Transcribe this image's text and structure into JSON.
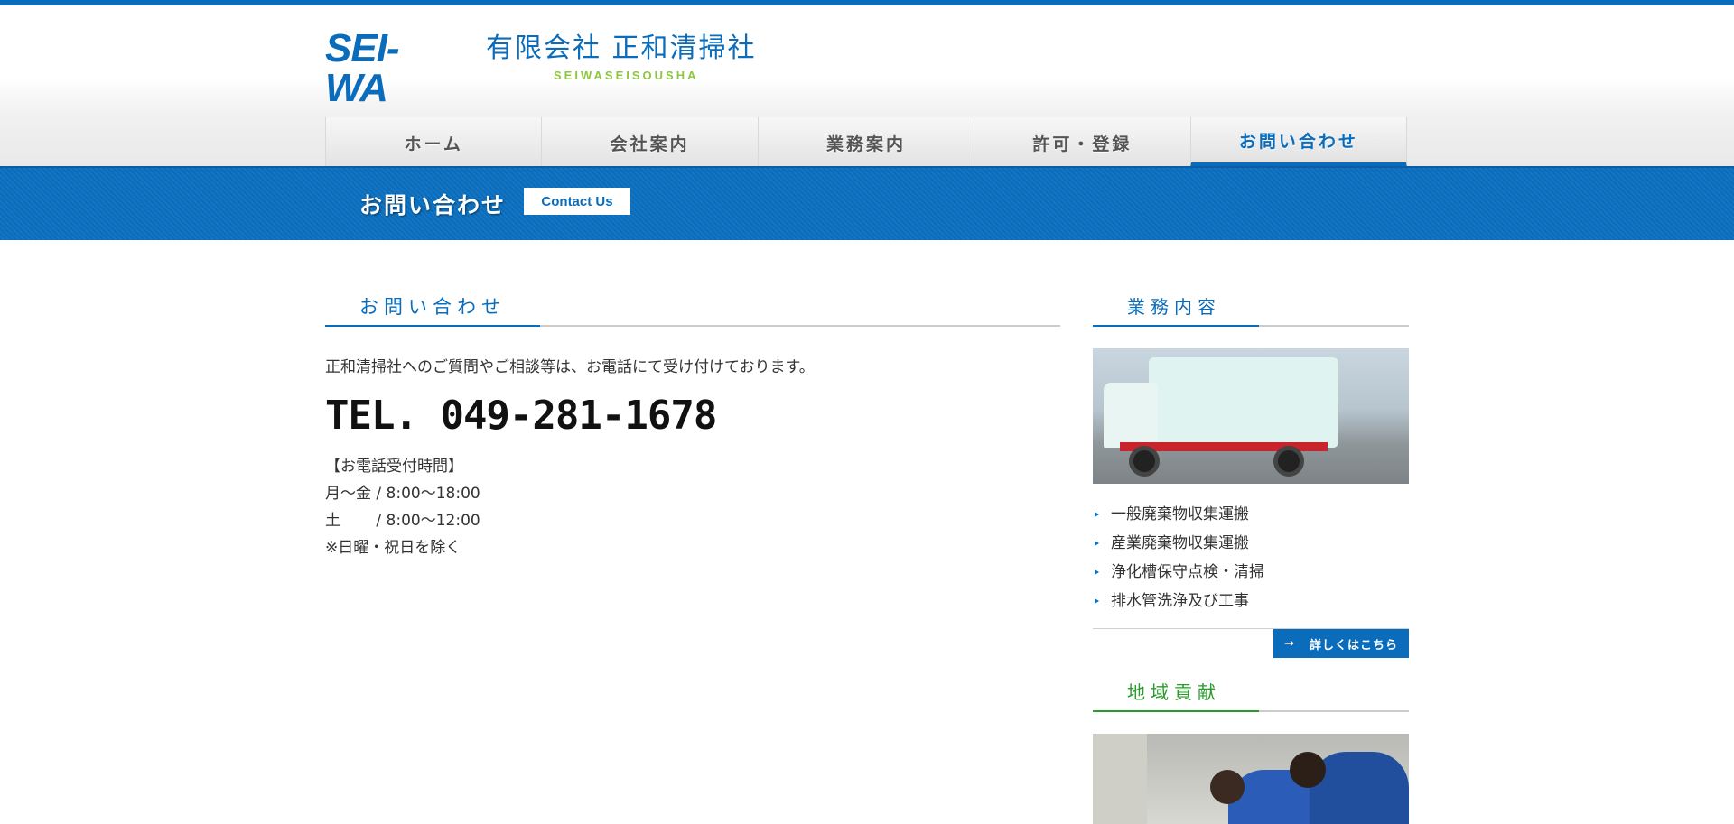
{
  "header": {
    "logo_mark": "SEI-WA",
    "company_name": "有限会社 正和清掃社",
    "company_romaji": "SEIWASEISOUSHA"
  },
  "nav": {
    "items": [
      {
        "label": "ホーム",
        "active": false
      },
      {
        "label": "会社案内",
        "active": false
      },
      {
        "label": "業務案内",
        "active": false
      },
      {
        "label": "許可・登録",
        "active": false
      },
      {
        "label": "お問い合わせ",
        "active": true
      }
    ]
  },
  "banner": {
    "title": "お問い合わせ",
    "tag": "Contact Us"
  },
  "main": {
    "section_title": "お問い合わせ",
    "lead": "正和清掃社へのご質問やご相談等は、お電話にて受け付けております。",
    "tel": "TEL. 049-281-1678",
    "hours": [
      "【お電話受付時間】",
      "月〜金 / 8:00〜18:00",
      "土　　 / 8:00〜12:00",
      "※日曜・祝日を除く"
    ]
  },
  "sidebar": {
    "business": {
      "title": "業務内容",
      "items": [
        "一般廃棄物収集運搬",
        "産業廃棄物収集運搬",
        "浄化槽保守点検・清掃",
        "排水管洗浄及び工事"
      ],
      "more_label": "詳しくはこちら",
      "more_arrow": "→"
    },
    "community": {
      "title": "地域貢献"
    }
  },
  "colors": {
    "brand_blue": "#0a6cba",
    "accent_green": "#2a9a2a",
    "logo_green": "#8dc63f"
  }
}
